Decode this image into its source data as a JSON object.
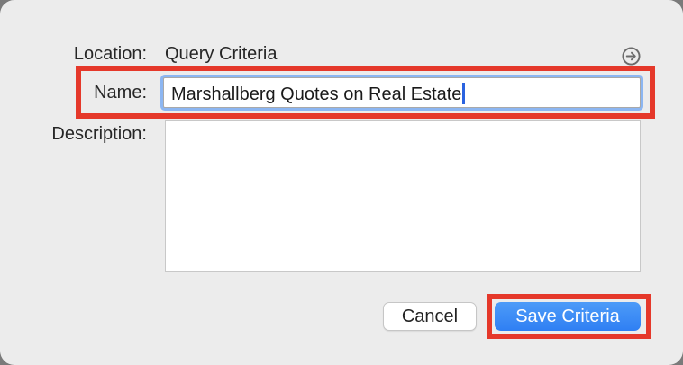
{
  "dialog": {
    "location_label": "Location:",
    "location_value": "Query Criteria",
    "name_label": "Name:",
    "name_value": "Marshallberg Quotes on Real Estate",
    "description_label": "Description:",
    "description_value": "",
    "reveal_icon": "arrow-circle-right-icon",
    "cancel_label": "Cancel",
    "save_label": "Save Criteria"
  },
  "colors": {
    "dialog_background": "#ececec",
    "accent": "#2f7ff3",
    "focus_ring": "#8cb6f2",
    "highlight": "#e5382a"
  }
}
